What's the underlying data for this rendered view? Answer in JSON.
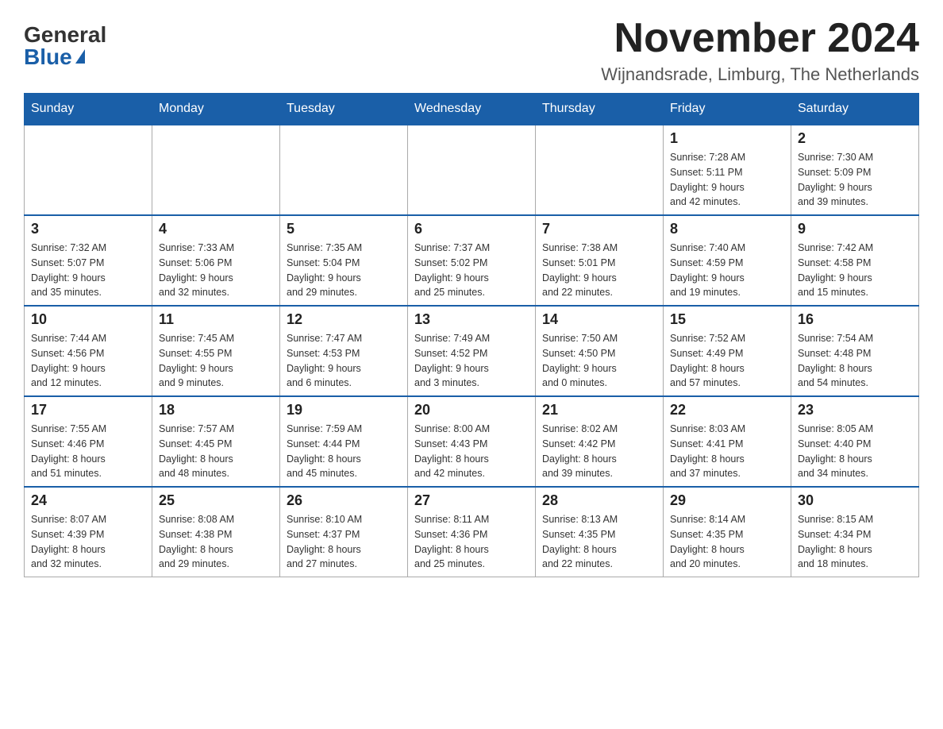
{
  "logo": {
    "general": "General",
    "blue": "Blue"
  },
  "header": {
    "month": "November 2024",
    "location": "Wijnandsrade, Limburg, The Netherlands"
  },
  "weekdays": [
    "Sunday",
    "Monday",
    "Tuesday",
    "Wednesday",
    "Thursday",
    "Friday",
    "Saturday"
  ],
  "weeks": [
    [
      {
        "day": "",
        "info": ""
      },
      {
        "day": "",
        "info": ""
      },
      {
        "day": "",
        "info": ""
      },
      {
        "day": "",
        "info": ""
      },
      {
        "day": "",
        "info": ""
      },
      {
        "day": "1",
        "info": "Sunrise: 7:28 AM\nSunset: 5:11 PM\nDaylight: 9 hours\nand 42 minutes."
      },
      {
        "day": "2",
        "info": "Sunrise: 7:30 AM\nSunset: 5:09 PM\nDaylight: 9 hours\nand 39 minutes."
      }
    ],
    [
      {
        "day": "3",
        "info": "Sunrise: 7:32 AM\nSunset: 5:07 PM\nDaylight: 9 hours\nand 35 minutes."
      },
      {
        "day": "4",
        "info": "Sunrise: 7:33 AM\nSunset: 5:06 PM\nDaylight: 9 hours\nand 32 minutes."
      },
      {
        "day": "5",
        "info": "Sunrise: 7:35 AM\nSunset: 5:04 PM\nDaylight: 9 hours\nand 29 minutes."
      },
      {
        "day": "6",
        "info": "Sunrise: 7:37 AM\nSunset: 5:02 PM\nDaylight: 9 hours\nand 25 minutes."
      },
      {
        "day": "7",
        "info": "Sunrise: 7:38 AM\nSunset: 5:01 PM\nDaylight: 9 hours\nand 22 minutes."
      },
      {
        "day": "8",
        "info": "Sunrise: 7:40 AM\nSunset: 4:59 PM\nDaylight: 9 hours\nand 19 minutes."
      },
      {
        "day": "9",
        "info": "Sunrise: 7:42 AM\nSunset: 4:58 PM\nDaylight: 9 hours\nand 15 minutes."
      }
    ],
    [
      {
        "day": "10",
        "info": "Sunrise: 7:44 AM\nSunset: 4:56 PM\nDaylight: 9 hours\nand 12 minutes."
      },
      {
        "day": "11",
        "info": "Sunrise: 7:45 AM\nSunset: 4:55 PM\nDaylight: 9 hours\nand 9 minutes."
      },
      {
        "day": "12",
        "info": "Sunrise: 7:47 AM\nSunset: 4:53 PM\nDaylight: 9 hours\nand 6 minutes."
      },
      {
        "day": "13",
        "info": "Sunrise: 7:49 AM\nSunset: 4:52 PM\nDaylight: 9 hours\nand 3 minutes."
      },
      {
        "day": "14",
        "info": "Sunrise: 7:50 AM\nSunset: 4:50 PM\nDaylight: 9 hours\nand 0 minutes."
      },
      {
        "day": "15",
        "info": "Sunrise: 7:52 AM\nSunset: 4:49 PM\nDaylight: 8 hours\nand 57 minutes."
      },
      {
        "day": "16",
        "info": "Sunrise: 7:54 AM\nSunset: 4:48 PM\nDaylight: 8 hours\nand 54 minutes."
      }
    ],
    [
      {
        "day": "17",
        "info": "Sunrise: 7:55 AM\nSunset: 4:46 PM\nDaylight: 8 hours\nand 51 minutes."
      },
      {
        "day": "18",
        "info": "Sunrise: 7:57 AM\nSunset: 4:45 PM\nDaylight: 8 hours\nand 48 minutes."
      },
      {
        "day": "19",
        "info": "Sunrise: 7:59 AM\nSunset: 4:44 PM\nDaylight: 8 hours\nand 45 minutes."
      },
      {
        "day": "20",
        "info": "Sunrise: 8:00 AM\nSunset: 4:43 PM\nDaylight: 8 hours\nand 42 minutes."
      },
      {
        "day": "21",
        "info": "Sunrise: 8:02 AM\nSunset: 4:42 PM\nDaylight: 8 hours\nand 39 minutes."
      },
      {
        "day": "22",
        "info": "Sunrise: 8:03 AM\nSunset: 4:41 PM\nDaylight: 8 hours\nand 37 minutes."
      },
      {
        "day": "23",
        "info": "Sunrise: 8:05 AM\nSunset: 4:40 PM\nDaylight: 8 hours\nand 34 minutes."
      }
    ],
    [
      {
        "day": "24",
        "info": "Sunrise: 8:07 AM\nSunset: 4:39 PM\nDaylight: 8 hours\nand 32 minutes."
      },
      {
        "day": "25",
        "info": "Sunrise: 8:08 AM\nSunset: 4:38 PM\nDaylight: 8 hours\nand 29 minutes."
      },
      {
        "day": "26",
        "info": "Sunrise: 8:10 AM\nSunset: 4:37 PM\nDaylight: 8 hours\nand 27 minutes."
      },
      {
        "day": "27",
        "info": "Sunrise: 8:11 AM\nSunset: 4:36 PM\nDaylight: 8 hours\nand 25 minutes."
      },
      {
        "day": "28",
        "info": "Sunrise: 8:13 AM\nSunset: 4:35 PM\nDaylight: 8 hours\nand 22 minutes."
      },
      {
        "day": "29",
        "info": "Sunrise: 8:14 AM\nSunset: 4:35 PM\nDaylight: 8 hours\nand 20 minutes."
      },
      {
        "day": "30",
        "info": "Sunrise: 8:15 AM\nSunset: 4:34 PM\nDaylight: 8 hours\nand 18 minutes."
      }
    ]
  ]
}
